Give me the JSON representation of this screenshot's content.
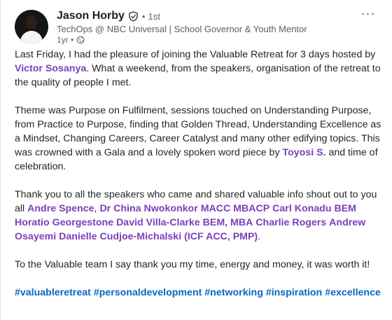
{
  "author": {
    "name": "Jason Horby",
    "verified_icon": "verified-shield-icon",
    "separator": "•",
    "degree": "1st",
    "headline": "TechOps @ NBC Universal | School Governor & Youth Mentor",
    "time": "1yr •",
    "visibility_icon": "globe-icon"
  },
  "more_button": "···",
  "paragraphs": {
    "p1": {
      "t1": "Last Friday, I had the pleasure of joining the Valuable Retreat for 3 days hosted by ",
      "m1": "Victor Sosanya",
      "t2": ". What a weekend, from the speakers, organisation of the retreat to the quality of people I met."
    },
    "p2": {
      "t1": "Theme was Purpose on Fulfilment, sessions touched on Understanding Purpose, from Practice to Purpose, finding that Golden Thread, Understanding Excellence as a Mindset, Changing Careers, Career Catalyst and many other edifying topics. This was crowned with a Gala and a lovely spoken word piece by ",
      "m1": "Toyosi S.",
      "t2": " and time of celebration."
    },
    "p3": {
      "t1": "Thank you to all the speakers who came and shared valuable info shout out to you all ",
      "m1": "Andre Spence",
      "s1": ", ",
      "m2": "Dr China Nwokonkor MACC MBACP",
      "s2": " ",
      "m3": "Carl Konadu BEM",
      "s3": " ",
      "m4": "Horatio Georgestone",
      "s4": " ",
      "m5": "David Villa-Clarke BEM, MBA",
      "s5": " ",
      "m6": "Charlie Rogers",
      "s6": " ",
      "m7": "Andrew Osayemi",
      "s7": " ",
      "m8": "Danielle Cudjoe-Michalski (ICF ACC, PMP)",
      "s8": "."
    },
    "p4": {
      "t1": "To the Valuable team I say thank you my time, energy and money, it was worth it!"
    }
  },
  "hashtags": [
    "#valuableretreat",
    "#personaldevelopment",
    "#networking",
    "#inspiration",
    "#excellence"
  ],
  "colors": {
    "mention": "#7b3fb8",
    "hashtag": "#0a66c2",
    "text": "#262626"
  }
}
